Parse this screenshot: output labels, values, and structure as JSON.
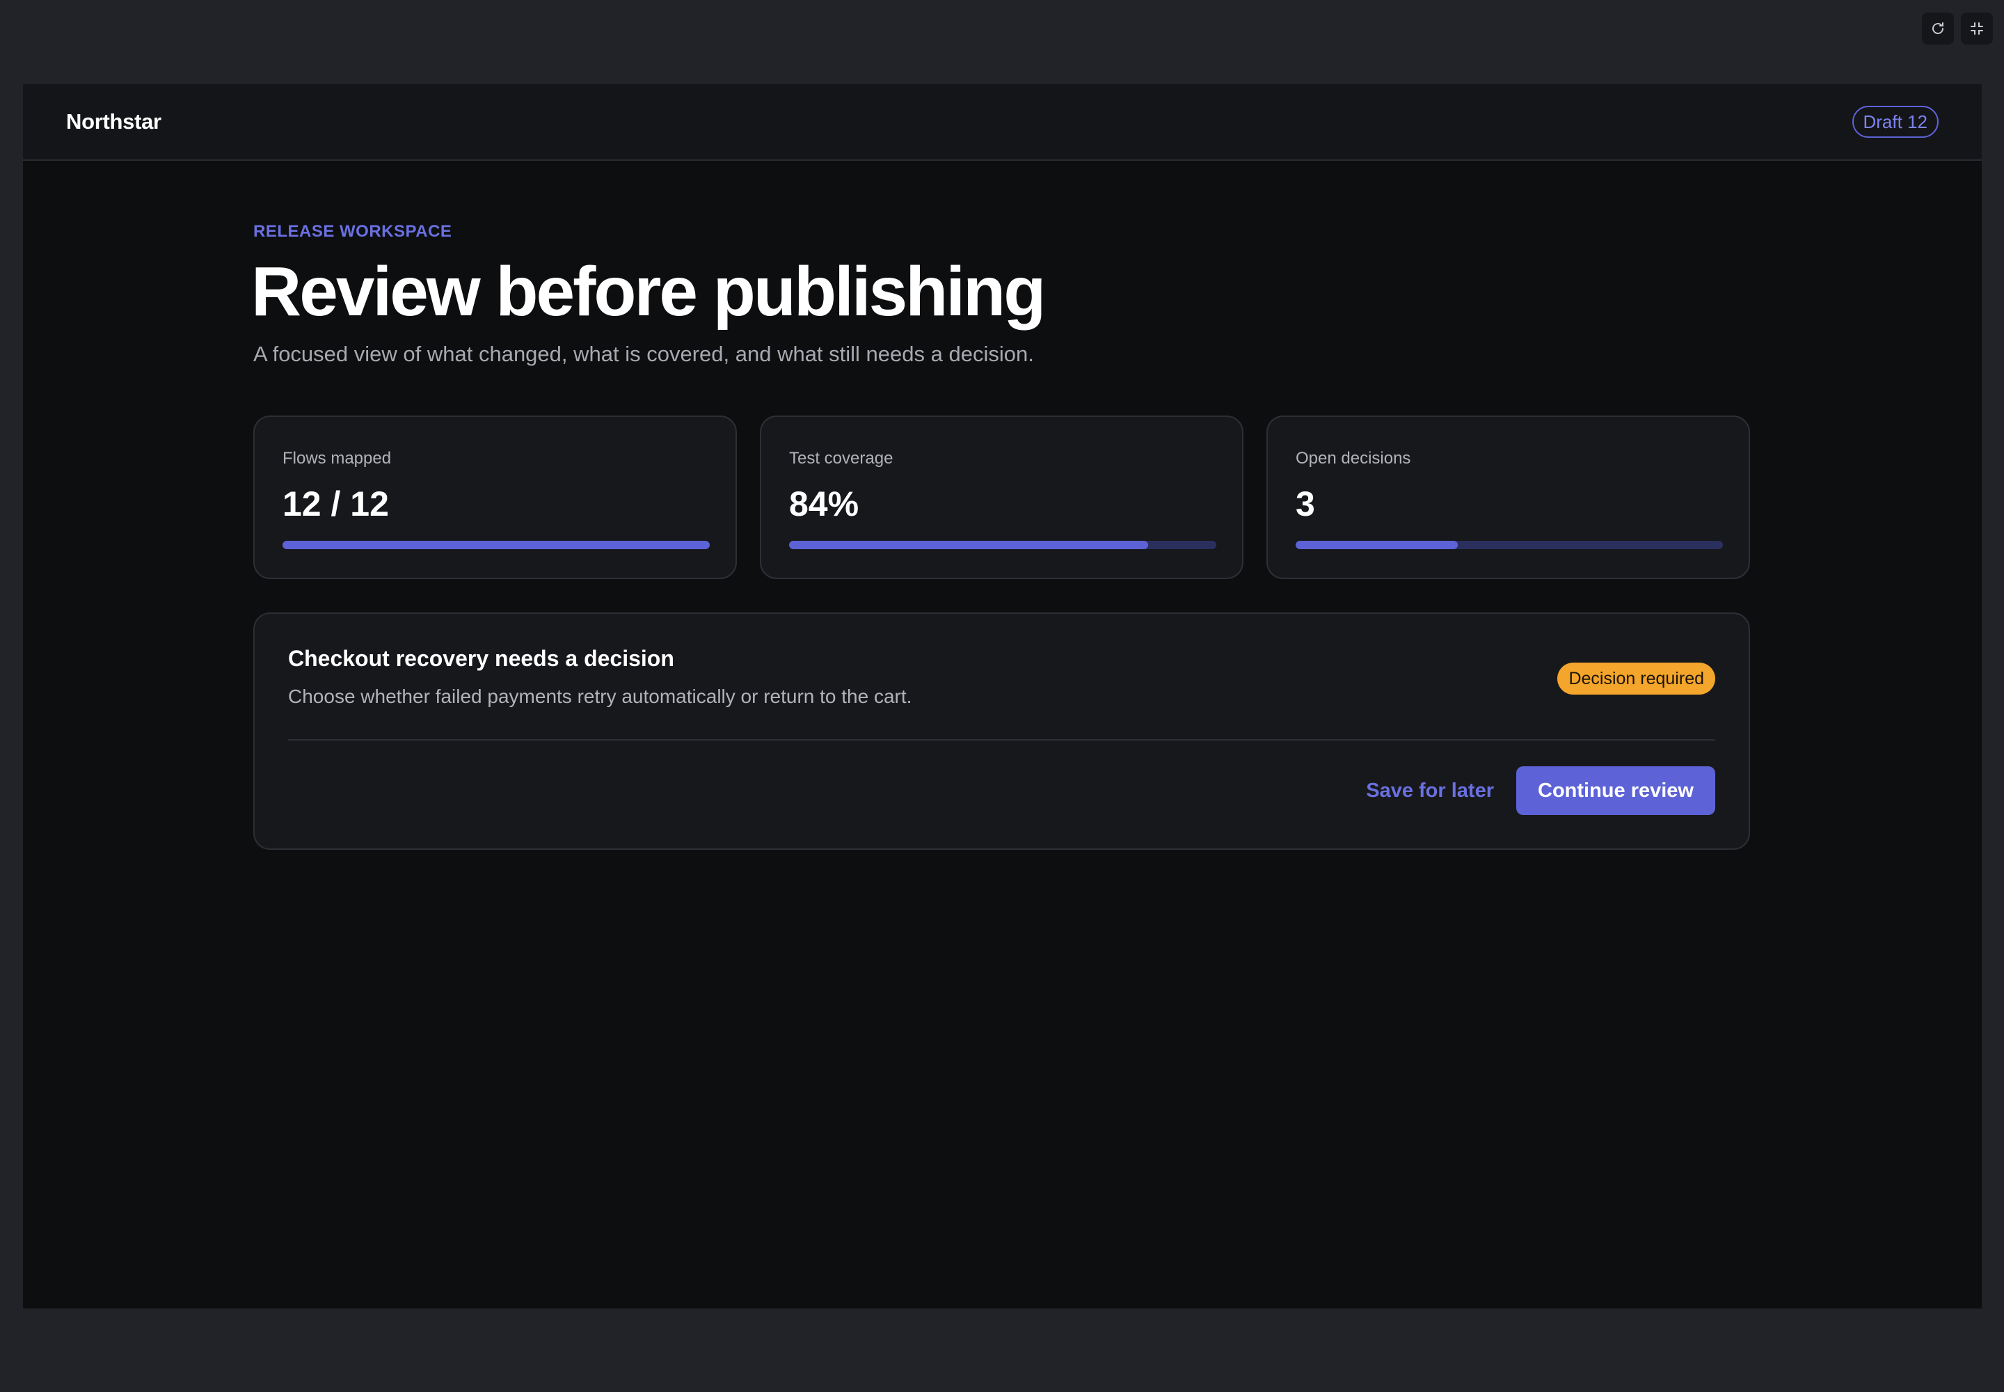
{
  "window": {
    "controls": [
      {
        "icon": "refresh-icon"
      },
      {
        "icon": "collapse-icon"
      }
    ]
  },
  "header": {
    "brand": "Northstar",
    "draft_label": "Draft 12"
  },
  "page": {
    "eyebrow": "RELEASE WORKSPACE",
    "title": "Review before publishing",
    "subtitle": "A focused view of what changed, what is covered, and what still needs a decision."
  },
  "stats": [
    {
      "label": "Flows mapped",
      "value": "12 / 12",
      "progress": 1.0
    },
    {
      "label": "Test coverage",
      "value": "84%",
      "progress": 0.84
    },
    {
      "label": "Open decisions",
      "value": "3",
      "progress": 0.38
    }
  ],
  "decision": {
    "title": "Checkout recovery needs a decision",
    "description": "Choose whether failed payments retry automatically or return to the cart.",
    "badge": "Decision required",
    "secondary_action": "Save for later",
    "primary_action": "Continue review"
  },
  "colors": {
    "accent": "#5d63d6",
    "accent_text": "#6a70e0",
    "warning": "#f4a52b",
    "track": "#2b2f5e",
    "background": "#0d0e10",
    "card": "#17181c"
  }
}
